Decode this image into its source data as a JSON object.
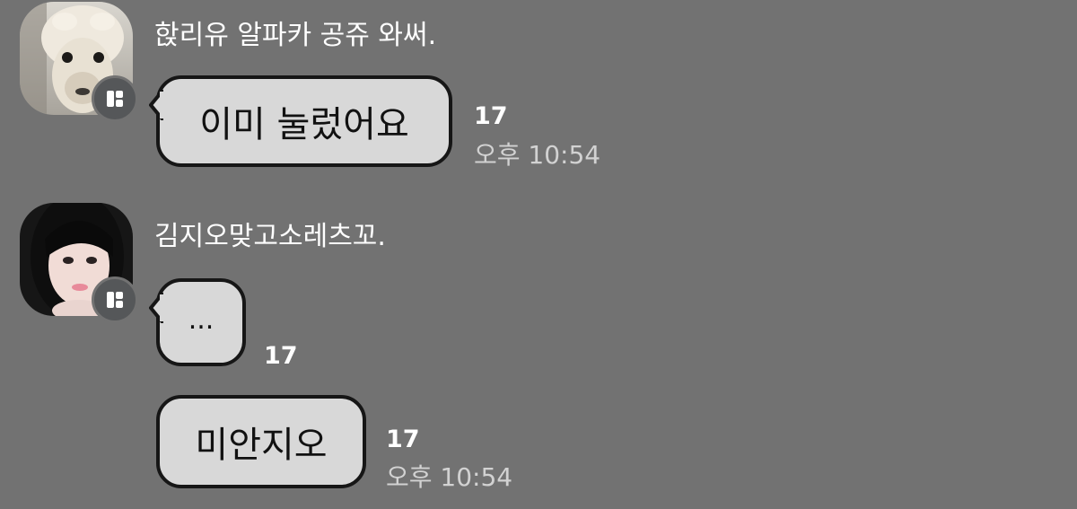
{
  "chat": {
    "colors": {
      "background": "#727272",
      "bubble": "#d8d8d8",
      "bubble_border": "#161616",
      "name_text": "#ffffff",
      "count_text": "#ffffff",
      "time_text": "#d2d2d2",
      "badge": "#555759"
    },
    "groups": [
      {
        "sender": "핝리유 알파카 공쥬 와써.",
        "avatar_icon": "alpaca-photo",
        "badge_icon": "profile-badge-icon",
        "messages": [
          {
            "text": "이미 눌렀어요",
            "count": "17",
            "time": "오후 10:54"
          }
        ]
      },
      {
        "sender": "김지오맞고소레츠꼬.",
        "avatar_icon": "girl-photo",
        "badge_icon": "profile-badge-icon",
        "messages": [
          {
            "text": "...",
            "count": "17"
          },
          {
            "text": "미안지오",
            "count": "17",
            "time": "오후 10:54"
          }
        ]
      }
    ]
  }
}
